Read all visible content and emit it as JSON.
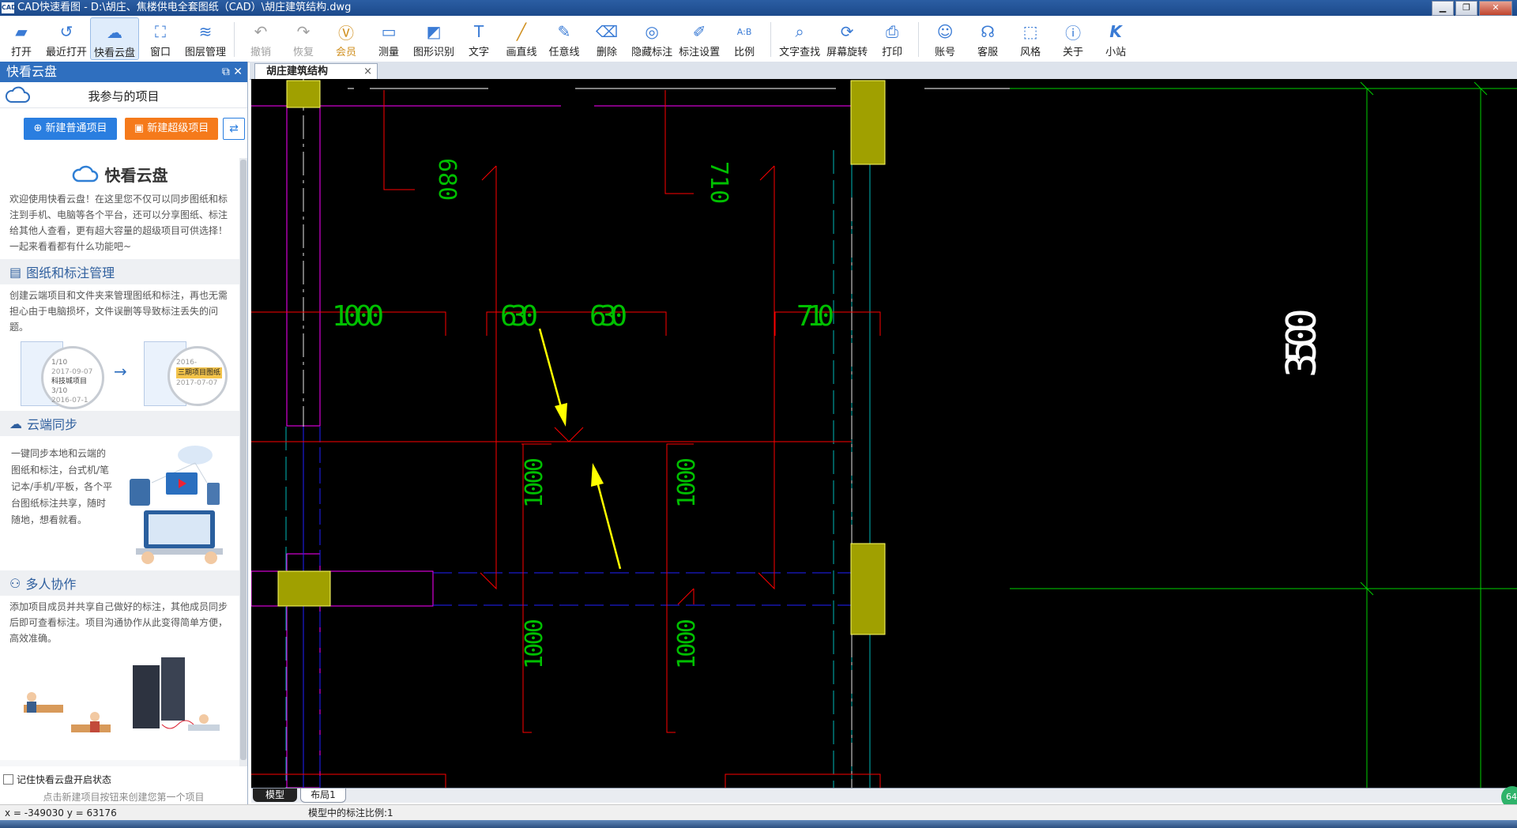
{
  "window": {
    "app_icon": "CAD",
    "title": "CAD快速看图 - D:\\胡庄、焦楼供电全套图纸（CAD）\\胡庄建筑结构.dwg",
    "controls": [
      "minimize-icon",
      "restore-icon",
      "close-icon"
    ]
  },
  "toolbar": {
    "items": [
      {
        "label": "打开",
        "icon": "open-folder-icon"
      },
      {
        "label": "最近打开",
        "icon": "history-icon"
      },
      {
        "label": "快看云盘",
        "icon": "cloud-icon"
      },
      {
        "label": "窗口",
        "icon": "window-icon"
      },
      {
        "label": "图层管理",
        "icon": "layers-icon"
      },
      {
        "label": "撤销",
        "icon": "undo-icon"
      },
      {
        "label": "恢复",
        "icon": "redo-icon"
      },
      {
        "label": "会员",
        "icon": "vip-icon"
      },
      {
        "label": "测量",
        "icon": "ruler-icon"
      },
      {
        "label": "图形识别",
        "icon": "shape-recognition-icon"
      },
      {
        "label": "文字",
        "icon": "text-icon"
      },
      {
        "label": "画直线",
        "icon": "line-icon"
      },
      {
        "label": "任意线",
        "icon": "freehand-icon"
      },
      {
        "label": "删除",
        "icon": "eraser-icon"
      },
      {
        "label": "隐藏标注",
        "icon": "hide-annotation-icon"
      },
      {
        "label": "标注设置",
        "icon": "annotation-settings-icon"
      },
      {
        "label": "比例",
        "icon": "scale-icon"
      },
      {
        "label": "文字查找",
        "icon": "text-search-icon"
      },
      {
        "label": "屏幕旋转",
        "icon": "rotate-screen-icon"
      },
      {
        "label": "打印",
        "icon": "printer-icon"
      },
      {
        "label": "账号",
        "icon": "account-icon"
      },
      {
        "label": "客服",
        "icon": "headset-icon"
      },
      {
        "label": "风格",
        "icon": "style-icon"
      },
      {
        "label": "关于",
        "icon": "info-icon"
      },
      {
        "label": "小站",
        "icon": "station-k-icon"
      }
    ]
  },
  "sidebar": {
    "header": "快看云盘",
    "projects_label": "我参与的项目",
    "btn_new_normal": "新建普通项目",
    "btn_new_super": "新建超级项目",
    "brand": "快看云盘",
    "intro": "欢迎使用快看云盘！在这里您不仅可以同步图纸和标注到手机、电脑等各个平台，还可以分享图纸、标注给其他人查看，更有超大容量的超级项目可供选择！一起来看看都有什么功能吧~",
    "sections": [
      {
        "title": "图纸和标注管理",
        "text": "创建云端项目和文件夹来管理图纸和标注，再也无需担心由于电脑损坏，文件误删等导致标注丢失的问题。",
        "illustration": {
          "left": {
            "project": "科技城项目",
            "date1": "2017-09-07",
            "count1": "1/10",
            "count2": "3/10",
            "date2": "2016-07-1"
          },
          "right": {
            "project": "三期项目图纸",
            "date": "2017-07-07",
            "date_top": "2016-"
          }
        }
      },
      {
        "title": "云端同步",
        "text": "一键同步本地和云端的图纸和标注，台式机/笔记本/手机/平板，各个平台图纸标注共享，随时随地，想看就看。"
      },
      {
        "title": "多人协作",
        "text": "添加项目成员并共享自己做好的标注，其他成员同步后即可查看标注。项目沟通协作从此变得简单方便，高效准确。"
      }
    ],
    "remember_checkbox": "记住快看云盘开启状态",
    "hint": "点击新建项目按钮来创建您第一个项目"
  },
  "doc_tab": {
    "label": "胡庄建筑结构",
    "close": "×"
  },
  "drawing": {
    "dims_top": [
      "680",
      "710"
    ],
    "dims_mid": [
      "1000",
      "630",
      "630",
      "710"
    ],
    "dims_vertical": [
      "1000",
      "1000",
      "1000",
      "1000"
    ],
    "dim_right": "3500",
    "colors": {
      "background": "#000000",
      "wall": "#ff0000",
      "column": "#a0a000",
      "beam": "#ff00ff",
      "dim": "#00c000",
      "arrow": "#ffff00",
      "axis": "#00ff00",
      "cyan": "#00c8c8",
      "blue": "#2020ff"
    }
  },
  "layout_tabs": [
    "模型",
    "布局1"
  ],
  "status": {
    "coords": "x = -349030  y = 63176",
    "scale_text": "模型中的标注比例:1"
  },
  "corner_badge": "64"
}
